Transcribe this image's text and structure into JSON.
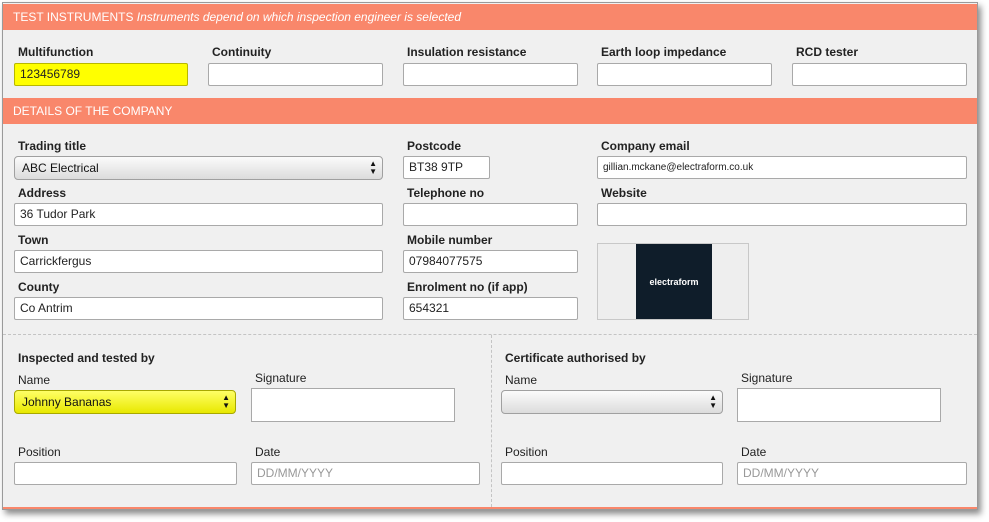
{
  "test_instruments": {
    "title": "TEST INSTRUMENTS",
    "note": "Instruments depend on which inspection engineer is selected",
    "fields": [
      {
        "label": "Multifunction",
        "value": "123456789"
      },
      {
        "label": "Continuity",
        "value": ""
      },
      {
        "label": "Insulation resistance",
        "value": ""
      },
      {
        "label": "Earth loop impedance",
        "value": ""
      },
      {
        "label": "RCD tester",
        "value": ""
      }
    ]
  },
  "company": {
    "title": "DETAILS OF THE COMPANY",
    "trading_title": {
      "label": "Trading title",
      "value": "ABC Electrical"
    },
    "address": {
      "label": "Address",
      "value": "36 Tudor Park"
    },
    "town": {
      "label": "Town",
      "value": "Carrickfergus"
    },
    "county": {
      "label": "County",
      "value": "Co Antrim"
    },
    "postcode": {
      "label": "Postcode",
      "value": "BT38 9TP"
    },
    "telephone": {
      "label": "Telephone no",
      "value": ""
    },
    "mobile": {
      "label": "Mobile number",
      "value": "07984077575"
    },
    "enrolment": {
      "label": "Enrolment no (if app)",
      "value": "654321"
    },
    "email": {
      "label": "Company email",
      "value": "gillian.mckane@electraform.co.uk"
    },
    "website": {
      "label": "Website",
      "value": ""
    },
    "logo_text": "electraform"
  },
  "inspected": {
    "title": "Inspected and tested by",
    "name_label": "Name",
    "name_value": "Johnny Bananas",
    "signature_label": "Signature",
    "position_label": "Position",
    "position_value": "",
    "date_label": "Date",
    "date_placeholder": "DD/MM/YYYY"
  },
  "authorised": {
    "title": "Certificate authorised by",
    "name_label": "Name",
    "name_value": "",
    "signature_label": "Signature",
    "position_label": "Position",
    "position_value": "",
    "date_label": "Date",
    "date_placeholder": "DD/MM/YYYY"
  },
  "colors": {
    "section_header": "#f9876b",
    "highlight": "#ffff00",
    "logo_background": "#0f1d2a"
  },
  "icons": {
    "select_arrows": "select-arrows-icon"
  }
}
